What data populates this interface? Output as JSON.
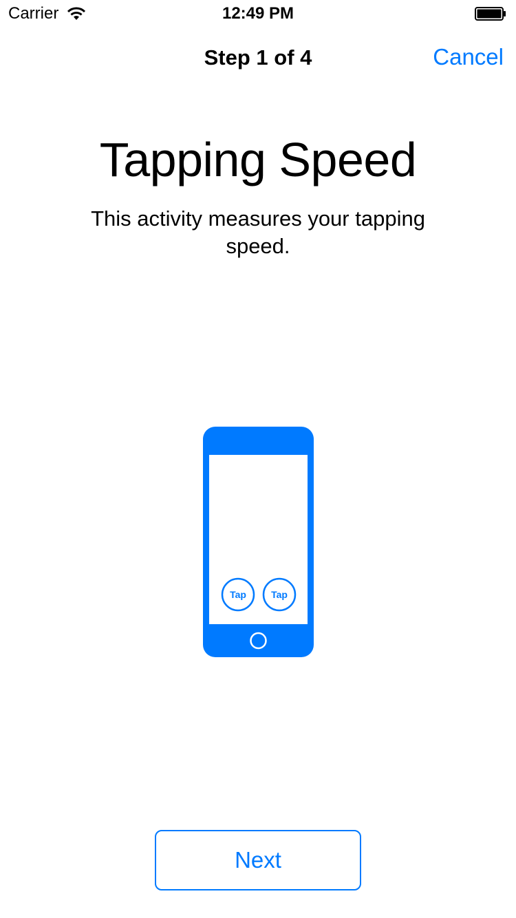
{
  "status_bar": {
    "carrier": "Carrier",
    "time": "12:49 PM",
    "wifi_icon": "wifi-icon",
    "battery_icon": "battery-icon"
  },
  "nav": {
    "title": "Step 1 of 4",
    "cancel_label": "Cancel"
  },
  "content": {
    "title": "Tapping Speed",
    "description": "This activity measures your tapping speed.",
    "illustration": {
      "icon": "phone-tapping-illustration",
      "tap_left_label": "Tap",
      "tap_right_label": "Tap"
    }
  },
  "footer": {
    "next_label": "Next"
  },
  "colors": {
    "accent": "#007AFF",
    "background": "#FFFFFF",
    "text": "#000000"
  }
}
